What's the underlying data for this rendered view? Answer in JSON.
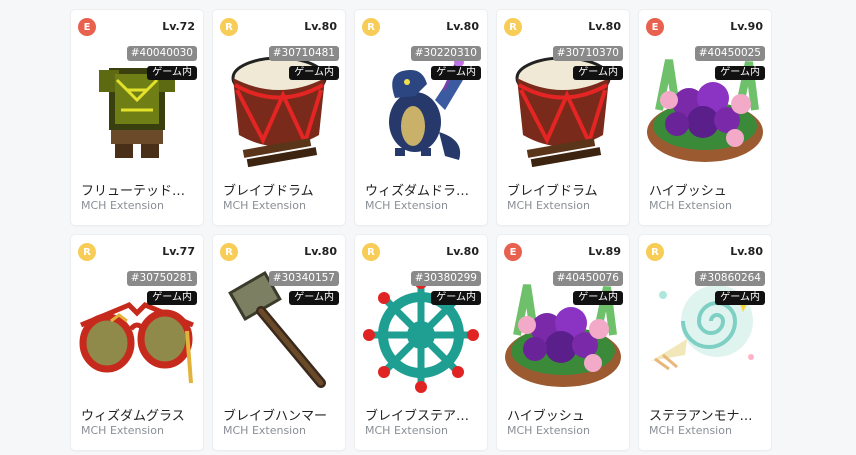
{
  "items": [
    {
      "rarity": "E",
      "level": "Lv.72",
      "token": "#40040030",
      "status": "ゲーム内",
      "name": "フリューテッド…",
      "extension": "MCH Extension",
      "art_icon": "armor-icon"
    },
    {
      "rarity": "R",
      "level": "Lv.80",
      "token": "#30710481",
      "status": "ゲーム内",
      "name": "ブレイブドラム",
      "extension": "MCH Extension",
      "art_icon": "drum-icon"
    },
    {
      "rarity": "R",
      "level": "Lv.80",
      "token": "#30220310",
      "status": "ゲーム内",
      "name": "ウィズダムドラ…",
      "extension": "MCH Extension",
      "art_icon": "dragon-icon"
    },
    {
      "rarity": "R",
      "level": "Lv.80",
      "token": "#30710370",
      "status": "ゲーム内",
      "name": "ブレイブドラム",
      "extension": "MCH Extension",
      "art_icon": "drum-icon"
    },
    {
      "rarity": "E",
      "level": "Lv.90",
      "token": "#40450025",
      "status": "ゲーム内",
      "name": "ハイブッシュ",
      "extension": "MCH Extension",
      "art_icon": "berry-basket-icon"
    },
    {
      "rarity": "R",
      "level": "Lv.77",
      "token": "#30750281",
      "status": "ゲーム内",
      "name": "ウィズダムグラス",
      "extension": "MCH Extension",
      "art_icon": "glasses-icon"
    },
    {
      "rarity": "R",
      "level": "Lv.80",
      "token": "#30340157",
      "status": "ゲーム内",
      "name": "ブレイブハンマー",
      "extension": "MCH Extension",
      "art_icon": "hammer-icon"
    },
    {
      "rarity": "R",
      "level": "Lv.80",
      "token": "#30380299",
      "status": "ゲーム内",
      "name": "ブレイブステア…",
      "extension": "MCH Extension",
      "art_icon": "ship-wheel-icon"
    },
    {
      "rarity": "E",
      "level": "Lv.89",
      "token": "#40450076",
      "status": "ゲーム内",
      "name": "ハイブッシュ",
      "extension": "MCH Extension",
      "art_icon": "berry-basket-icon"
    },
    {
      "rarity": "R",
      "level": "Lv.80",
      "token": "#30860264",
      "status": "ゲーム内",
      "name": "ステラアンモナ…",
      "extension": "MCH Extension",
      "art_icon": "ammonite-icon"
    }
  ],
  "colors": {
    "rarity_E": "#e8604e",
    "rarity_R": "#f7cd57"
  }
}
